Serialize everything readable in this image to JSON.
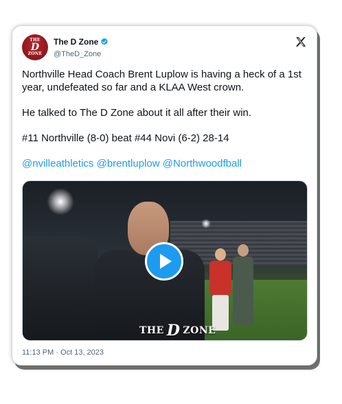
{
  "author": {
    "display_name": "The D Zone",
    "handle": "@TheD_Zone",
    "avatar_text": [
      "THE",
      "D",
      "ZONE"
    ],
    "verified": true
  },
  "tweet": {
    "line1": "Northville Head Coach Brent Luplow is having a heck of a 1st year, undefeated so far and a KLAA West crown.",
    "line2": "He talked to The D Zone about it all after their win.",
    "line3": "#11 Northville (8-0) beat #44 Novi (6-2) 28-14",
    "mentions": [
      "@nvilleathletics",
      "@brentluplow",
      "@Northwoodfball"
    ]
  },
  "media": {
    "type": "video",
    "watermark_left": "THE",
    "watermark_mid": "D",
    "watermark_right": "ZONE"
  },
  "timestamp": "11:13 PM · Oct 13, 2023",
  "colors": {
    "accent": "#1d9bf0",
    "avatar_bg": "#9b1c22",
    "text": "#0f1419",
    "muted": "#536471"
  },
  "icons": {
    "verified": "verified-badge-icon",
    "brand": "x-logo-icon",
    "play": "play-icon"
  }
}
